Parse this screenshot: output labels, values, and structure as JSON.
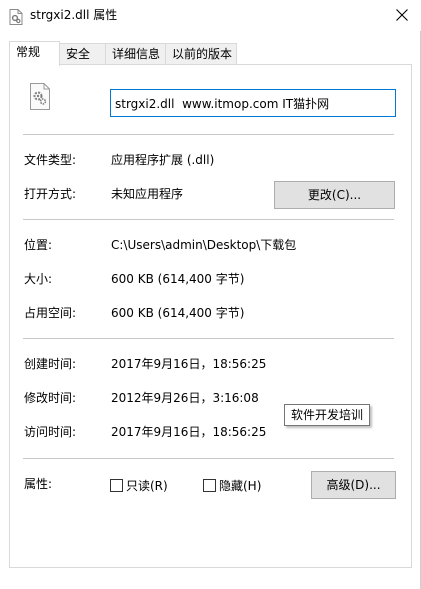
{
  "window": {
    "title": "strgxi2.dll 属性",
    "icon": "dll-file-icon",
    "close_icon": "close-icon"
  },
  "tabs": [
    {
      "label": "常规",
      "active": true
    },
    {
      "label": "安全",
      "active": false
    },
    {
      "label": "详细信息",
      "active": false
    },
    {
      "label": "以前的版本",
      "active": false
    }
  ],
  "general": {
    "file_name": "strgxi2.dll  www.itmop.com IT猫扑网",
    "file_type_label": "文件类型:",
    "file_type_value": "应用程序扩展 (.dll)",
    "open_with_label": "打开方式:",
    "open_with_value": "未知应用程序",
    "change_button": "更改(C)...",
    "location_label": "位置:",
    "location_value": "C:\\Users\\admin\\Desktop\\下载包",
    "size_label": "大小:",
    "size_value": "600 KB (614,400 字节)",
    "size_on_disk_label": "占用空间:",
    "size_on_disk_value": "600 KB (614,400 字节)",
    "created_label": "创建时间:",
    "created_value": "2017年9月16日，18:56:25",
    "modified_label": "修改时间:",
    "modified_value": "2012年9月26日，3:16:08",
    "accessed_label": "访问时间:",
    "accessed_value": "2017年9月16日，18:56:25",
    "attributes_label": "属性:",
    "readonly_label": "只读(R)",
    "hidden_label": "隐藏(H)",
    "readonly_checked": false,
    "hidden_checked": false,
    "advanced_button": "高级(D)..."
  },
  "tooltip": {
    "text": "软件开发培训"
  },
  "colors": {
    "accent": "#0078d7",
    "button_bg": "#e1e1e1",
    "button_border": "#adadad",
    "separator": "#c8c8c8"
  }
}
